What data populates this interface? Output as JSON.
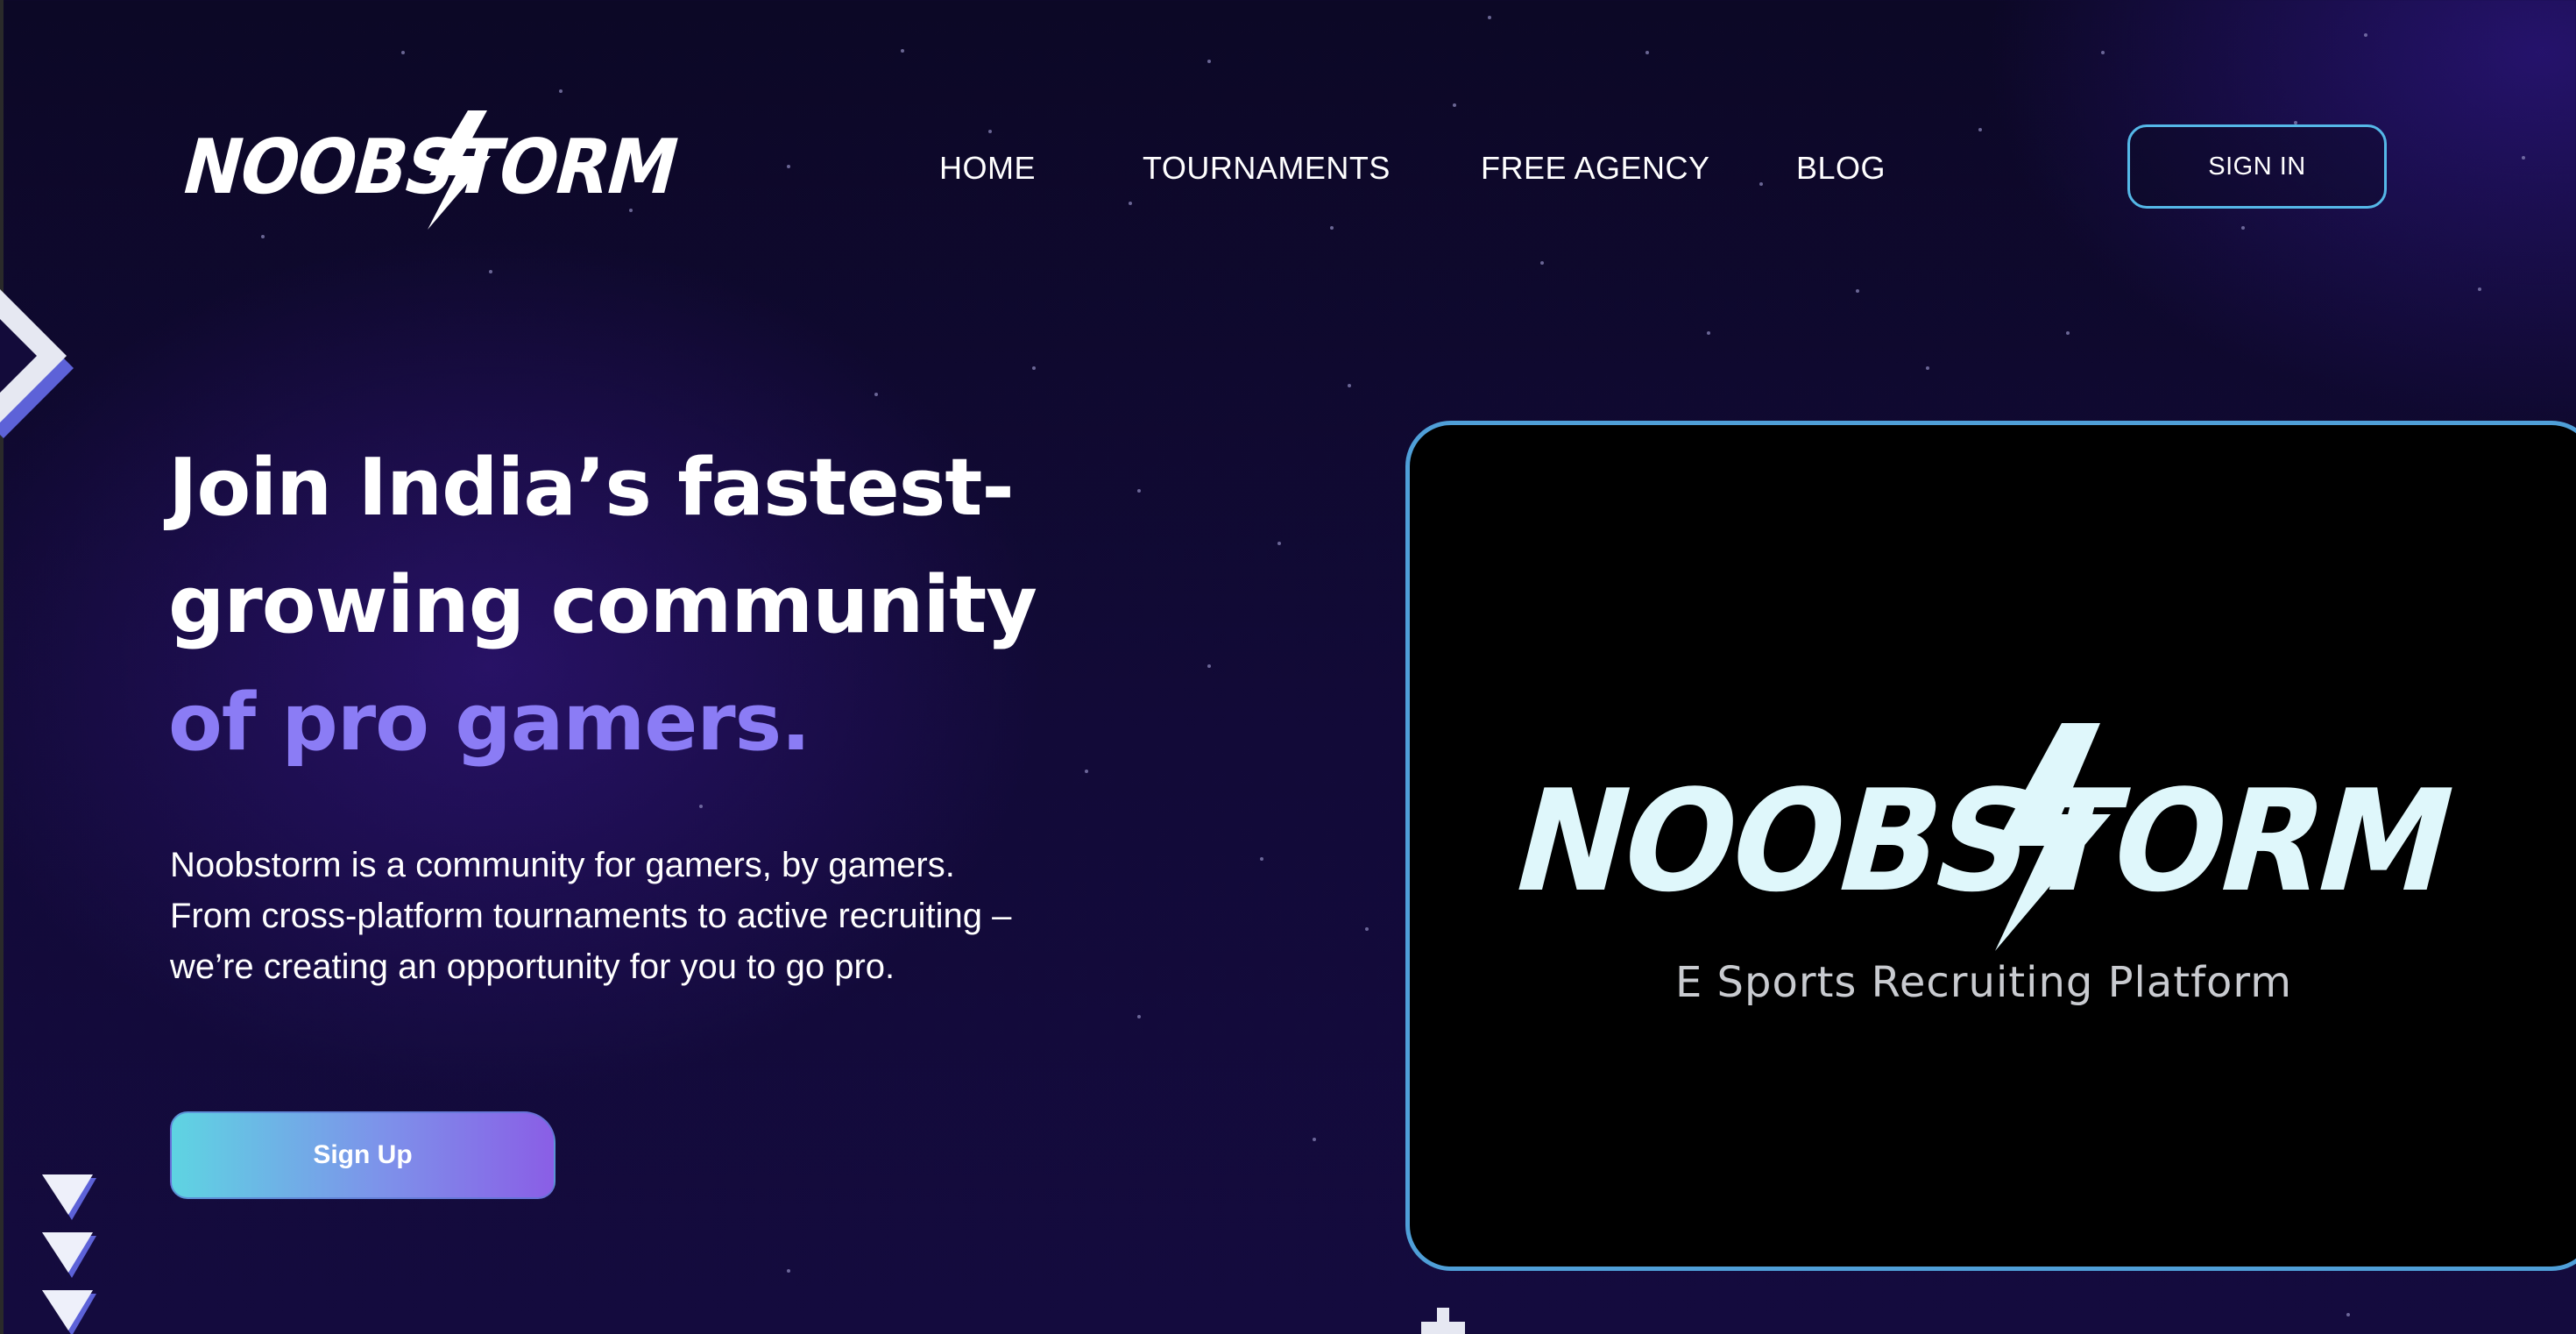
{
  "brand": {
    "logo_text": "NOOBSTORM"
  },
  "nav": {
    "items": [
      {
        "label": "HOME"
      },
      {
        "label": "TOURNAMENTS"
      },
      {
        "label": "FREE AGENCY"
      },
      {
        "label": "BLOG"
      }
    ],
    "signin_label": "SIGN IN"
  },
  "hero": {
    "title_line1": "Join India’s fastest-",
    "title_line2": "growing community",
    "title_accent": "of pro gamers.",
    "description": "Noobstorm is a community for gamers, by gamers. From cross-platform tournaments to active recruiting – we’re creating an opportunity for you to go pro.",
    "signup_label": "Sign Up"
  },
  "video": {
    "logo_text": "NOOBSTORM",
    "subtitle": "E Sports Recruiting Platform"
  },
  "colors": {
    "background": "#120a38",
    "accent_purple": "#8b7cf5",
    "border_blue": "#4f9fd8",
    "button_gradient_start": "#5ed4e2",
    "button_gradient_end": "#8a5ee6",
    "logo_glow": "#dff7fb"
  }
}
